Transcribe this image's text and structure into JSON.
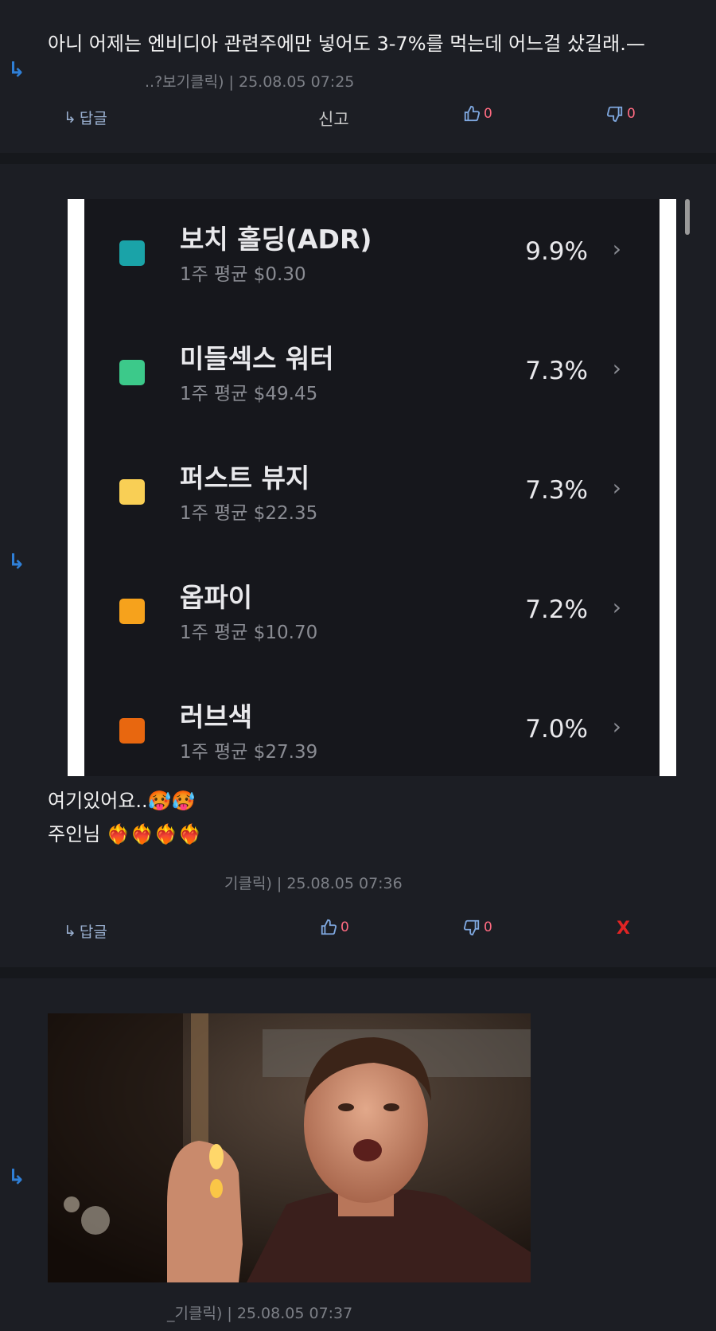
{
  "comments": [
    {
      "text": "아니 어제는 엔비디아 관련주에만 넣어도 3-7%를 먹는데 어느걸 샀길래.—",
      "meta": "..?보기클릭) | 25.08.05 07:25",
      "actions": {
        "reply": "답글",
        "report": "신고",
        "likes": "0",
        "dislikes": "0"
      }
    },
    {
      "line1": "여기있어요..🥵🥵",
      "line2": "주인님 ❤️‍🔥❤️‍🔥❤️‍🔥❤️‍🔥",
      "meta": "기클릭) | 25.08.05 07:36",
      "actions": {
        "reply": "답글",
        "likes": "0",
        "dislikes": "0",
        "delete": "X"
      }
    },
    {
      "meta": "_기클릭) | 25.08.05 07:37"
    }
  ],
  "reply_icon": "reply-arrow-icon",
  "stocks": [
    {
      "name": "보치 홀딩(ADR)",
      "avg": "1주 평균 $0.30",
      "pct": "9.9%",
      "color": "#1aa3a8"
    },
    {
      "name": "미들섹스 워터",
      "avg": "1주 평균 $49.45",
      "pct": "7.3%",
      "color": "#3cc98a"
    },
    {
      "name": "퍼스트 뷰지",
      "avg": "1주 평균 $22.35",
      "pct": "7.3%",
      "color": "#f9cf55"
    },
    {
      "name": "옵파이",
      "avg": "1주 평균 $10.70",
      "pct": "7.2%",
      "color": "#f6a21c"
    },
    {
      "name": "러브색",
      "avg": "1주 평균 $27.39",
      "pct": "7.0%",
      "color": "#e8670f"
    }
  ],
  "colors": {
    "background": "#1c1e24",
    "reply_icon": "#2f7fd6",
    "count": "#ff6b81",
    "delete": "#e02424"
  }
}
